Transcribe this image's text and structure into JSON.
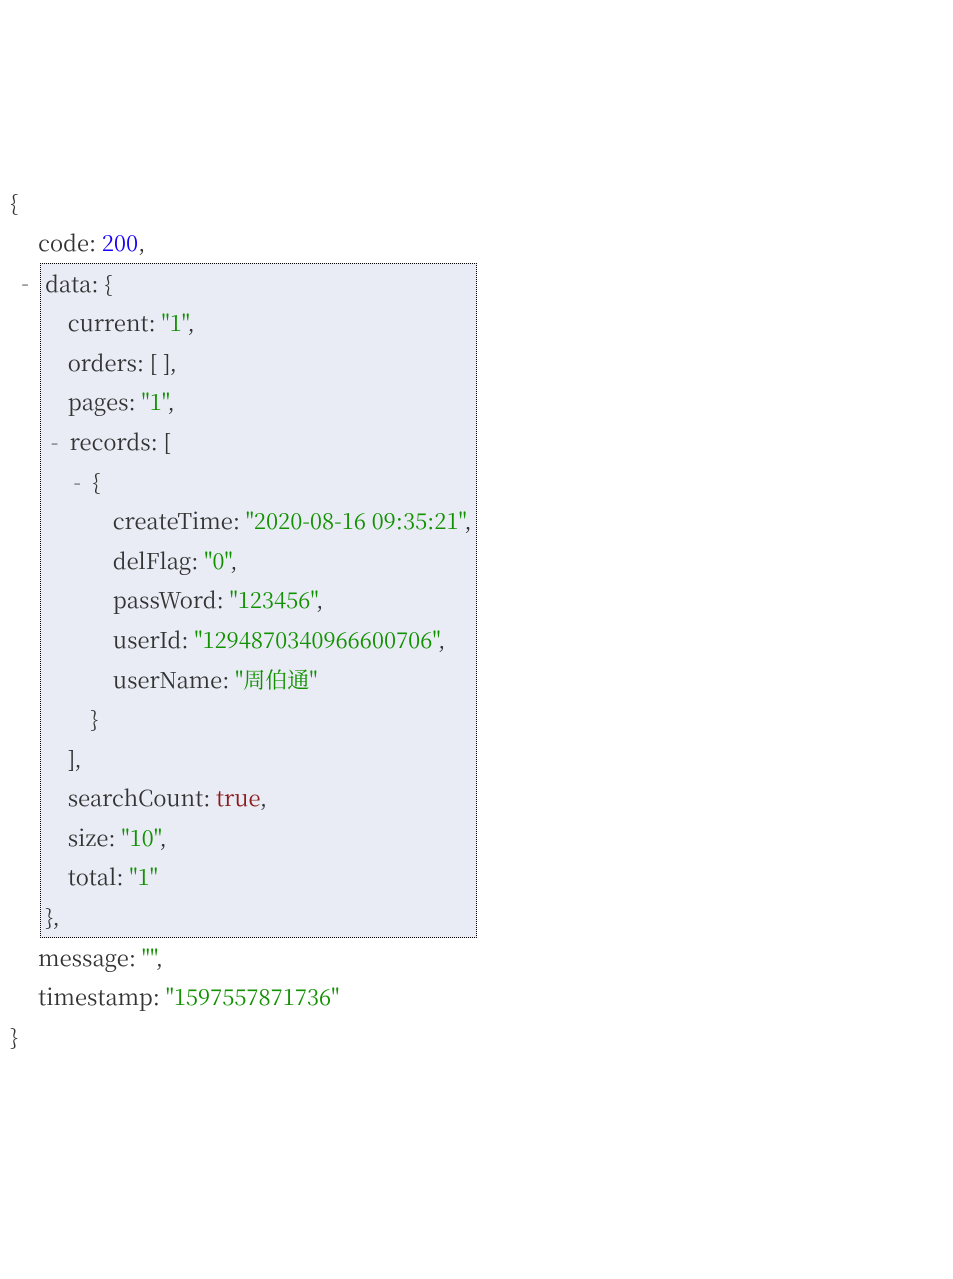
{
  "json": {
    "open_brace": "{",
    "close_brace": "}",
    "open_bracket": "[",
    "close_bracket": "]",
    "empty_array": "[ ]",
    "comma": ",",
    "colon": ": ",
    "toggle_minus": "-",
    "keys": {
      "code": "code",
      "data": "data",
      "current": "current",
      "orders": "orders",
      "pages": "pages",
      "records": "records",
      "createTime": "createTime",
      "delFlag": "delFlag",
      "passWord": "passWord",
      "userId": "userId",
      "userName": "userName",
      "searchCount": "searchCount",
      "size": "size",
      "total": "total",
      "message": "message",
      "timestamp": "timestamp"
    },
    "values": {
      "code": "200",
      "current": "\"1\"",
      "pages": "\"1\"",
      "createTime": "\"2020-08-16 09:35:21\"",
      "delFlag": "\"0\"",
      "passWord": "\"123456\"",
      "userId": "\"1294870340966600706\"",
      "userName": "\"周伯通\"",
      "searchCount": "true",
      "size": "\"10\"",
      "total": "\"1\"",
      "message": "\"\"",
      "timestamp": "\"1597557871736\""
    }
  }
}
